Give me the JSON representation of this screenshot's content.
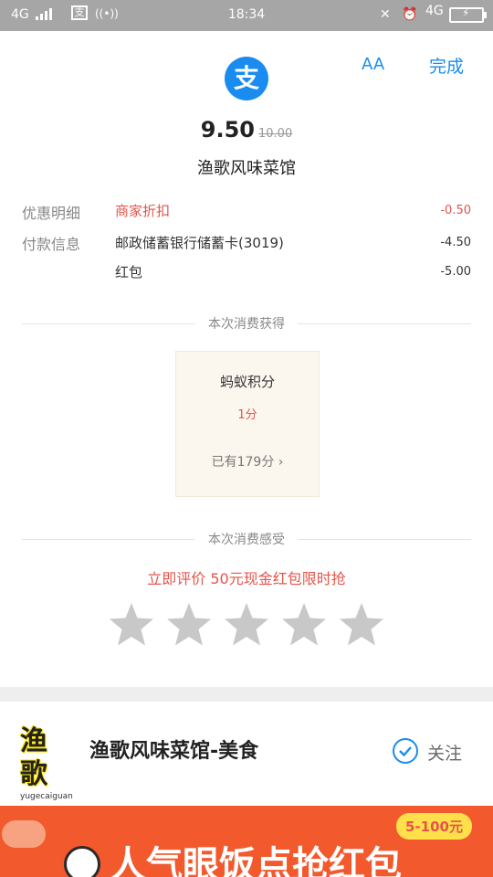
{
  "status_bar": {
    "network_left": "4G",
    "time": "18:34",
    "network_right": "4G"
  },
  "header": {
    "logo_glyph": "支",
    "aa_label": "AA",
    "done_label": "完成"
  },
  "payment": {
    "amount": "9.50",
    "original_amount": "10.00",
    "merchant": "渔歌风味菜馆"
  },
  "details": {
    "discount_label": "优惠明细",
    "discount_item": "商家折扣",
    "discount_value": "-0.50",
    "payment_label": "付款信息",
    "payment_item": "邮政储蓄银行储蓄卡(3019)",
    "payment_value": "-4.50",
    "redpacket_item": "红包",
    "redpacket_value": "-5.00"
  },
  "earned": {
    "section_title": "本次消费获得",
    "card_title": "蚂蚁积分",
    "card_points": "1分",
    "card_total": "已有179分",
    "chevron": "›"
  },
  "feedback": {
    "section_title": "本次消费感受",
    "promo_text": "立即评价 50元现金红包限时抢",
    "star_count": 5,
    "rating": 0
  },
  "shop": {
    "logo_text": "渔歌",
    "logo_subtext": "yugecaiguan",
    "name": "渔歌风味菜馆-美食",
    "follow_label": "关注"
  },
  "banner": {
    "text": "人气眼饭点抢红包",
    "badge": "5-100元"
  },
  "colors": {
    "accent": "#1a8cf0",
    "red": "#e5544b",
    "banner": "#f25a2e",
    "star": "#c8c8c8"
  }
}
